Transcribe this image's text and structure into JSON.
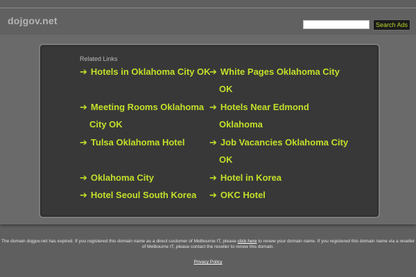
{
  "header": {
    "site_name": "dojgov.net",
    "search_button": "Search Ads"
  },
  "related": {
    "title": "Related Links",
    "links": [
      {
        "text": "Hotels in Oklahoma City OK"
      },
      {
        "text": "Meeting Rooms Oklahoma"
      },
      {
        "text": "Tulsa Oklahoma Hotel"
      },
      {
        "text": "Oklahoma City"
      },
      {
        "text": "Hotel Seoul South Korea"
      },
      {
        "text": "White Pages Oklahoma City"
      },
      {
        "text": "Hotels Near Edmond"
      },
      {
        "text": "Job Vacancies Oklahoma City"
      },
      {
        "text": "Hotel in Korea"
      },
      {
        "text": "OKC Hotel"
      }
    ],
    "wraps": {
      "meeting_rooms": "City OK",
      "white_pages": "OK",
      "edmond": "Oklahoma",
      "job_vacancies": "OK"
    }
  },
  "footer": {
    "text_before_link": "The domain dojgov.net has expired. If you registered this domain name as a direct customer of Melbourne IT, please ",
    "link": "click here",
    "text_after_link": " to renew your domain name. If you registered this domain name via a reseller of Melbourne IT, please contact the reseller to renew this domain.",
    "privacy": "Privacy Policy"
  }
}
